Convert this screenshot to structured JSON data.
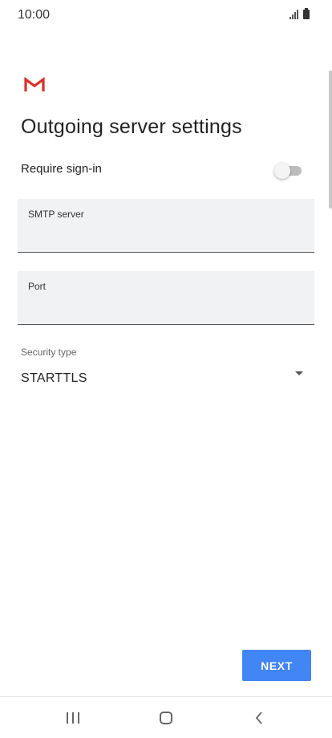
{
  "status_bar": {
    "time": "10:00",
    "signal_icon": "signal-icon",
    "battery_icon": "battery-icon"
  },
  "header": {
    "logo_icon": "gmail-logo-icon",
    "logo_colors": [
      "#d93025",
      "#ea4335"
    ],
    "title": "Outgoing server settings"
  },
  "sign_in": {
    "label": "Require sign-in",
    "enabled": false
  },
  "smtp_server": {
    "label": "SMTP server",
    "value": ""
  },
  "port": {
    "label": "Port",
    "value": ""
  },
  "security": {
    "label": "Security type",
    "selected": "STARTTLS",
    "dropdown_icon": "dropdown-arrow-icon"
  },
  "actions": {
    "next_label": "NEXT",
    "accent_color": "#4285f4"
  },
  "nav_bar": {
    "recents_icon": "recents-icon",
    "home_icon": "home-icon",
    "back_icon": "back-icon"
  }
}
